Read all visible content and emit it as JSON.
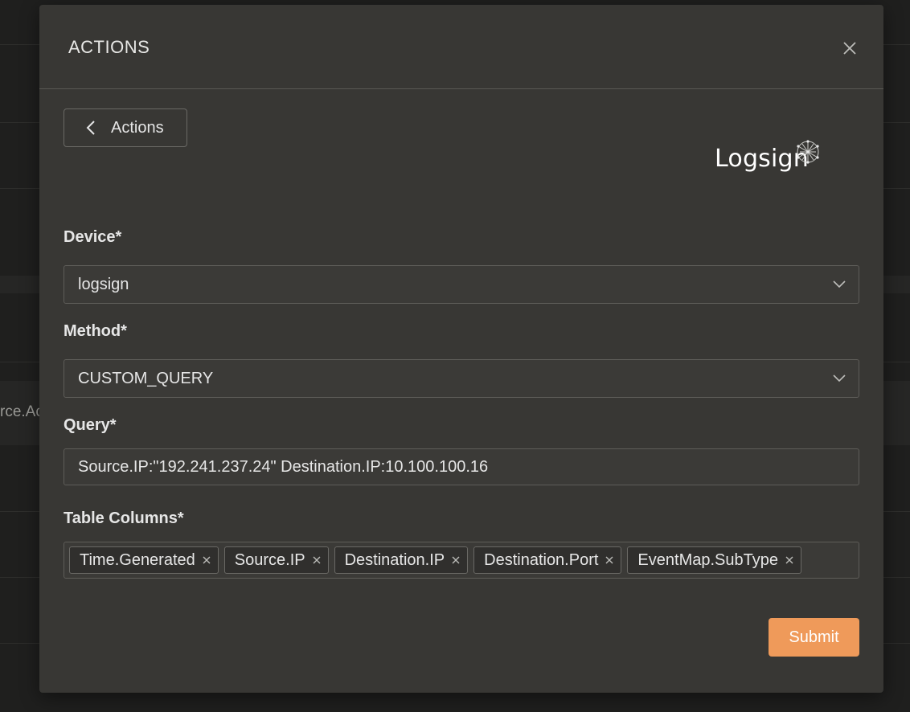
{
  "background": {
    "partial_text": "rce.Ac"
  },
  "modal": {
    "title": "ACTIONS",
    "close_icon": "close-icon",
    "back_button": {
      "label": "Actions",
      "icon": "chevron-left-icon"
    },
    "logo": {
      "text": "Logsign"
    },
    "fields": {
      "device": {
        "label": "Device*",
        "value": "logsign"
      },
      "method": {
        "label": "Method*",
        "value": "CUSTOM_QUERY"
      },
      "query": {
        "label": "Query*",
        "value": "Source.IP:\"192.241.237.24\" Destination.IP:10.100.100.16"
      },
      "table_columns": {
        "label": "Table Columns*",
        "tags": [
          "Time.Generated",
          "Source.IP",
          "Destination.IP",
          "Destination.Port",
          "EventMap.SubType"
        ]
      }
    },
    "submit_label": "Submit"
  },
  "colors": {
    "accent": "#ef9a5a",
    "modal_bg": "#383734",
    "page_bg": "#1f1f1e"
  }
}
